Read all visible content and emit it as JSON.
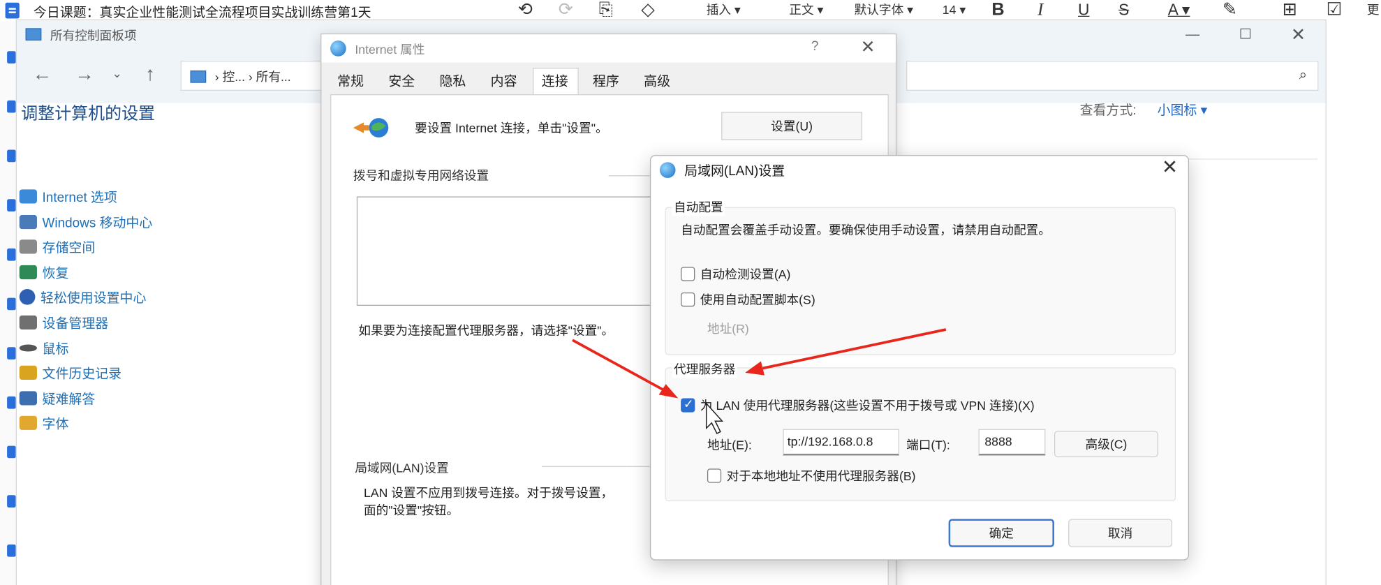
{
  "doc_editor": {
    "title": "今日课题：真实企业性能测试全流程项目实战训练营第1天",
    "toolbar": {
      "insert": "插入",
      "style": "正文",
      "font": "默认字体",
      "font_size": "14",
      "bold": "B",
      "italic": "I",
      "underline": "U",
      "strike": "S",
      "font_color": "A",
      "more": "更"
    },
    "icons": [
      "undo-icon",
      "redo-icon",
      "format-painter-icon",
      "eraser-icon",
      "highlight-icon",
      "ai-icon",
      "checkbox-icon"
    ]
  },
  "control_panel": {
    "window_title": "所有控制面板项",
    "breadcrumb": "› 控... › 所有...",
    "heading": "调整计算机的设置",
    "view_label": "查看方式:",
    "view_value": "小图标 ▾",
    "items": [
      {
        "label": "Internet 选项",
        "icon": "internet-options-icon",
        "color": "#3b8ad9"
      },
      {
        "label": "Windows 移动中心",
        "icon": "mobility-center-icon",
        "color": "#4a7ab8"
      },
      {
        "label": "存储空间",
        "icon": "storage-spaces-icon",
        "color": "#8a8a8a"
      },
      {
        "label": "恢复",
        "icon": "recovery-icon",
        "color": "#2e8b57"
      },
      {
        "label": "轻松使用设置中心",
        "icon": "ease-of-access-icon",
        "color": "#2f5fb3"
      },
      {
        "label": "设备管理器",
        "icon": "device-manager-icon",
        "color": "#707070"
      },
      {
        "label": "鼠标",
        "icon": "mouse-icon",
        "color": "#555555"
      },
      {
        "label": "文件历史记录",
        "icon": "file-history-icon",
        "color": "#d9a520"
      },
      {
        "label": "疑难解答",
        "icon": "troubleshooting-icon",
        "color": "#3d6fb0"
      },
      {
        "label": "字体",
        "icon": "fonts-icon",
        "color": "#e0a82e"
      }
    ]
  },
  "internet_properties": {
    "title": "Internet 属性",
    "help": "?",
    "close": "✕",
    "tabs": [
      "常规",
      "安全",
      "隐私",
      "内容",
      "连接",
      "程序",
      "高级"
    ],
    "active_tab": "连接",
    "setup_text": "要设置 Internet 连接，单击\"设置\"。",
    "setup_button": "设置(U)",
    "dialup_label": "拨号和虚拟专用网络设置",
    "proxy_hint": "如果要为连接配置代理服务器，请选择\"设置\"。",
    "lan_label": "局域网(LAN)设置",
    "lan_desc_line1": "LAN 设置不应用到拨号连接。对于拨号设置，",
    "lan_desc_line2": "面的\"设置\"按钮。"
  },
  "lan_settings": {
    "title": "局域网(LAN)设置",
    "close": "✕",
    "auto_config": {
      "label": "自动配置",
      "description": "自动配置会覆盖手动设置。要确保使用手动设置，请禁用自动配置。",
      "auto_detect_label": "自动检测设置(A)",
      "auto_detect_checked": false,
      "script_label": "使用自动配置脚本(S)",
      "script_checked": false,
      "address_label": "地址(R)"
    },
    "proxy": {
      "label": "代理服务器",
      "use_proxy_label": "为 LAN 使用代理服务器(这些设置不用于拨号或 VPN 连接)(X)",
      "use_proxy_checked": true,
      "address_label": "地址(E):",
      "address_value": "tp://192.168.0.8",
      "port_label": "端口(T):",
      "port_value": "8888",
      "advanced_button": "高级(C)",
      "bypass_local_label": "对于本地地址不使用代理服务器(B)",
      "bypass_local_checked": false
    },
    "ok_button": "确定",
    "cancel_button": "取消"
  },
  "colors": {
    "accent": "#2a6fd1",
    "link": "#1e6fb5",
    "annotation_arrow": "#e8261c"
  }
}
